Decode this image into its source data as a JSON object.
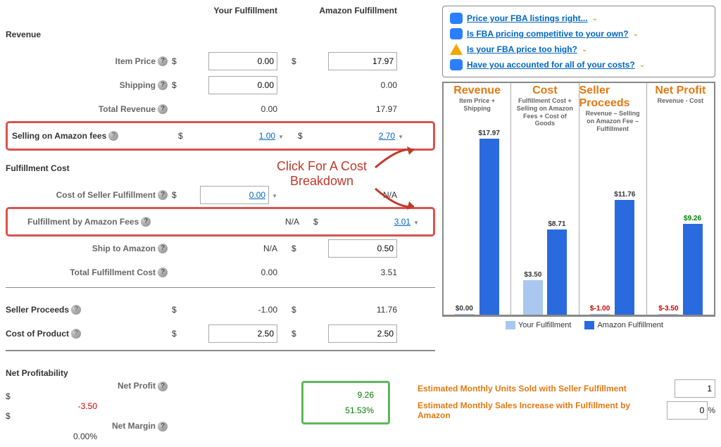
{
  "headers": {
    "your": "Your Fulfillment",
    "amazon": "Amazon Fulfillment"
  },
  "sections": {
    "revenue": "Revenue",
    "fulfillment_cost": "Fulfillment Cost",
    "net_profitability": "Net Profitability"
  },
  "rows": {
    "item_price": {
      "label": "Item Price",
      "your": "0.00",
      "amazon": "17.97"
    },
    "shipping": {
      "label": "Shipping",
      "your": "0.00",
      "amazon": "0.00"
    },
    "total_revenue": {
      "label": "Total Revenue",
      "your": "0.00",
      "amazon": "17.97"
    },
    "selling_fees": {
      "label": "Selling on Amazon fees",
      "your": "1.00",
      "amazon": "2.70"
    },
    "cost_seller_fulfillment": {
      "label": "Cost of Seller Fulfillment",
      "your": "0.00",
      "amazon": "N/A"
    },
    "fba_fees": {
      "label": "Fulfillment by Amazon Fees",
      "your": "N/A",
      "amazon": "3.01"
    },
    "ship_to_amazon": {
      "label": "Ship to Amazon",
      "your": "N/A",
      "amazon": "0.50"
    },
    "total_fulfillment": {
      "label": "Total Fulfillment Cost",
      "your": "0.00",
      "amazon": "3.51"
    },
    "seller_proceeds": {
      "label": "Seller Proceeds",
      "your": "-1.00",
      "amazon": "11.76"
    },
    "cost_of_product": {
      "label": "Cost of Product",
      "your": "2.50",
      "amazon": "2.50"
    },
    "net_profit": {
      "label": "Net Profit",
      "your": "-3.50",
      "amazon": "9.26"
    },
    "net_margin": {
      "label": "Net Margin",
      "your": "0.00%",
      "amazon": "51.53%"
    }
  },
  "currency": "$",
  "callout": "Click For A Cost\nBreakdown",
  "tips": [
    "Price your FBA listings right...",
    "Is FBA pricing competitive to your own?",
    "Is your FBA price too high?",
    "Have you accounted for all of your costs?"
  ],
  "chart_data": {
    "type": "bar",
    "columns": [
      {
        "title": "Revenue",
        "subtitle": "Item Price + Shipping",
        "your": 0.0,
        "amazon": 17.97,
        "your_label": "$0.00",
        "amazon_label": "$17.97"
      },
      {
        "title": "Cost",
        "subtitle": "Fulfillment Cost + Selling on Amazon Fees + Cost of Goods",
        "your": 3.5,
        "amazon": 8.71,
        "your_label": "$3.50",
        "amazon_label": "$8.71"
      },
      {
        "title": "Seller Proceeds",
        "subtitle": "Revenue – Selling on Amazon Fee – Fulfillment",
        "your": -1.0,
        "amazon": 11.76,
        "your_label": "$-1.00",
        "amazon_label": "$11.76"
      },
      {
        "title": "Net Profit",
        "subtitle": "Revenue - Cost",
        "your": -3.5,
        "amazon": 9.26,
        "your_label": "$-3.50",
        "amazon_label": "$9.26",
        "amazon_color": "green"
      }
    ],
    "ymax": 18,
    "legend": {
      "your": "Your Fulfillment",
      "amazon": "Amazon Fulfillment"
    }
  },
  "estimates": {
    "monthly_units": {
      "label": "Estimated Monthly Units Sold with Seller Fulfillment",
      "value": "1"
    },
    "sales_increase": {
      "label": "Estimated Monthly Sales Increase with Fulfillment by Amazon",
      "value": "0",
      "unit": "%"
    }
  }
}
